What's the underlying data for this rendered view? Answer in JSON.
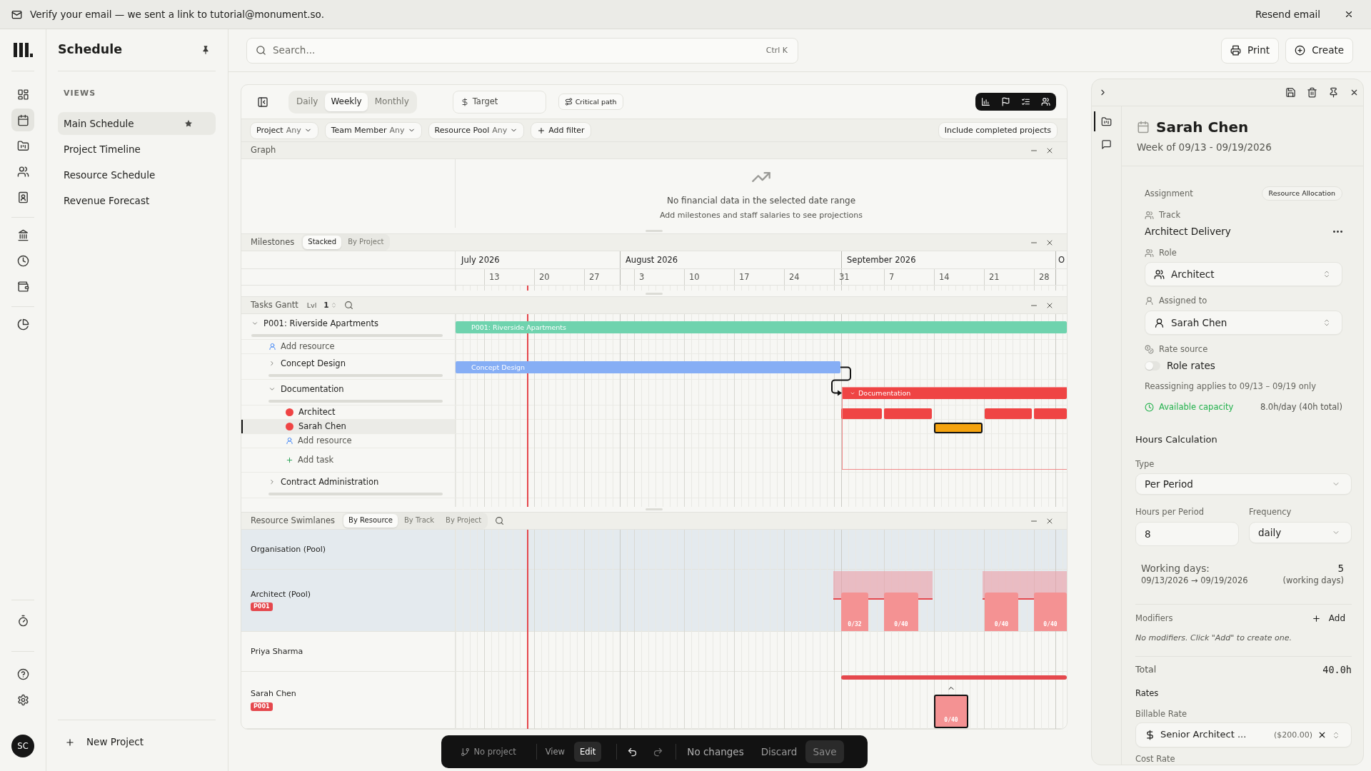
{
  "banner": {
    "message": "Verify your email — we sent a link to tutorial@monument.so.",
    "action": "Resend email"
  },
  "nav_rail": {
    "groups": [
      [
        {
          "selected": false
        },
        {
          "selected": true
        },
        {
          "selected": false
        },
        {
          "selected": false
        },
        {
          "selected": false
        }
      ],
      [
        {
          "selected": false
        },
        {
          "selected": false
        },
        {
          "selected": false
        }
      ],
      [
        {
          "selected": false
        }
      ]
    ],
    "bottom_groups": [
      [
        {
          "selected": false
        }
      ],
      [
        {
          "selected": false
        },
        {
          "selected": false
        }
      ]
    ],
    "avatar": "SC"
  },
  "sidebar": {
    "title": "Schedule",
    "section": "VIEWS",
    "items": [
      {
        "label": "Main Schedule",
        "selected": true,
        "starred": true
      },
      {
        "label": "Project Timeline",
        "selected": false,
        "starred": false
      },
      {
        "label": "Resource Schedule",
        "selected": false,
        "starred": false
      },
      {
        "label": "Revenue Forecast",
        "selected": false,
        "starred": false
      }
    ],
    "new_project": "New Project"
  },
  "header": {
    "search": {
      "placeholder": "Search...",
      "shortcut": "Ctrl K"
    },
    "buttons": [
      {
        "kind": "print",
        "label": "Print"
      },
      {
        "kind": "create",
        "label": "Create"
      }
    ]
  },
  "toolbar": {
    "scales": [
      {
        "label": "Daily",
        "selected": false
      },
      {
        "label": "Weekly",
        "selected": true
      },
      {
        "label": "Monthly",
        "selected": false
      }
    ],
    "target": {
      "placeholder": "Target"
    },
    "critical_path": "Critical path",
    "panels": [
      {
        "on": true
      },
      {
        "on": true
      },
      {
        "on": true
      },
      {
        "on": true
      }
    ]
  },
  "filters": {
    "chips": [
      {
        "label": "Project",
        "value": "Any"
      },
      {
        "label": "Team Member",
        "value": "Any"
      },
      {
        "label": "Resource Pool",
        "value": "Any"
      }
    ],
    "add": "Add filter",
    "include_completed": "Include completed projects"
  },
  "graph": {
    "title": "Graph",
    "empty_title": "No financial data in the selected date range",
    "empty_hint": "Add milestones and staff salaries to see projections"
  },
  "milestones": {
    "title": "Milestones",
    "modes": [
      {
        "label": "Stacked",
        "selected": true
      },
      {
        "label": "By Project",
        "selected": false
      }
    ],
    "months": [
      "July 2026",
      "August 2026",
      "September 2026",
      "O"
    ],
    "weeks": [
      "13",
      "20",
      "27",
      "3",
      "10",
      "17",
      "24",
      "31",
      "7",
      "14",
      "21",
      "28"
    ]
  },
  "tasks_gantt": {
    "title": "Tasks Gantt",
    "level_label": "Lvl",
    "level_value": "1",
    "rows": [
      {
        "kind": "project",
        "label": "P001: Riverside Apartments",
        "bar_label": "P001: Riverside Apartments",
        "color": "#6fd3ae",
        "expanded": true,
        "selected": false,
        "children": [
          {
            "kind": "add_resource",
            "label": "Add resource",
            "selected": false
          },
          {
            "kind": "task",
            "label": "Concept Design",
            "bar_label": "Concept Design",
            "color": "#86aef5",
            "expanded": false,
            "selected": false
          },
          {
            "kind": "task",
            "label": "Documentation",
            "bar_label": "Documentation",
            "color": "#ef4444",
            "expanded": true,
            "selected": false,
            "children": [
              {
                "kind": "resource",
                "label": "Architect",
                "color": "#ef4444",
                "selected": false
              },
              {
                "kind": "resource",
                "label": "Sarah Chen",
                "color": "#ef4444",
                "selected": true
              },
              {
                "kind": "add_resource",
                "label": "Add resource",
                "selected": false
              },
              {
                "kind": "add_task",
                "label": "Add task",
                "selected": false
              }
            ]
          },
          {
            "kind": "task",
            "label": "Contract Administration",
            "expanded": false,
            "selected": false
          }
        ]
      }
    ]
  },
  "swimlanes": {
    "title": "Resource Swimlanes",
    "modes": [
      {
        "label": "By Resource",
        "selected": true
      },
      {
        "label": "By Track",
        "selected": false
      },
      {
        "label": "By Project",
        "selected": false
      }
    ],
    "rows": [
      {
        "kind": "pool",
        "label": "Organisation (Pool)"
      },
      {
        "kind": "pool",
        "label": "Architect (Pool)",
        "tags": [
          "P001"
        ],
        "blocks": [
          {
            "label": "0/32",
            "selected": false
          },
          {
            "label": "0/40",
            "selected": false
          },
          {
            "label": "0/40",
            "selected": false
          },
          {
            "label": "0/40",
            "selected": false
          }
        ]
      },
      {
        "kind": "person",
        "label": "Priya Sharma"
      },
      {
        "kind": "person",
        "label": "Sarah Chen",
        "tags": [
          "P001"
        ],
        "blocks": [
          {
            "label": "0/40",
            "selected": true
          }
        ]
      }
    ]
  },
  "edit_bar": {
    "project": "No project",
    "modes": [
      {
        "label": "View",
        "selected": false
      },
      {
        "label": "Edit",
        "selected": true
      }
    ],
    "undo": {
      "disabled": false
    },
    "redo": {
      "disabled": true
    },
    "status": "No changes",
    "discard": {
      "label": "Discard",
      "disabled": true
    },
    "save": {
      "label": "Save",
      "disabled": true
    }
  },
  "detail_panel": {
    "tabs": [
      {
        "selected": true
      },
      {
        "selected": false
      }
    ],
    "title": "Sarah Chen",
    "subtitle": "Week of 09/13 - 09/19/2026",
    "assignment": {
      "label": "Assignment",
      "badge": "Resource Allocation",
      "track_label": "Track",
      "track_value": "Architect Delivery",
      "role_label": "Role",
      "role_value": "Architect",
      "assignee_label": "Assigned to",
      "assignee_value": "Sarah Chen",
      "rate_source_label": "Rate source",
      "rate_source": {
        "label": "Role rates",
        "on": false
      },
      "note": "Reassigning applies to 09/13 – 09/19 only",
      "capacity_label": "Available capacity",
      "capacity_value": "8.0h/day (40h total)"
    },
    "hours": {
      "title": "Hours Calculation",
      "type_label": "Type",
      "type_value": "Per Period",
      "per_period_label": "Hours per Period",
      "per_period_value": "8",
      "frequency_label": "Frequency",
      "frequency_value": "daily",
      "working_days_label": "Working days:",
      "working_days_count": "5",
      "working_days_range": "09/13/2026 → 09/19/2026",
      "working_days_unit": "(working days)",
      "modifiers_label": "Modifiers",
      "modifiers_add": "Add",
      "modifiers_empty": "No modifiers. Click \"Add\" to create one.",
      "total_label": "Total",
      "total_value": "40.0h"
    },
    "rates": {
      "title": "Rates",
      "billable_label": "Billable Rate",
      "billable_value": "Senior Architect ...",
      "billable_amount": "($200.00)",
      "cost_label": "Cost Rate"
    }
  }
}
